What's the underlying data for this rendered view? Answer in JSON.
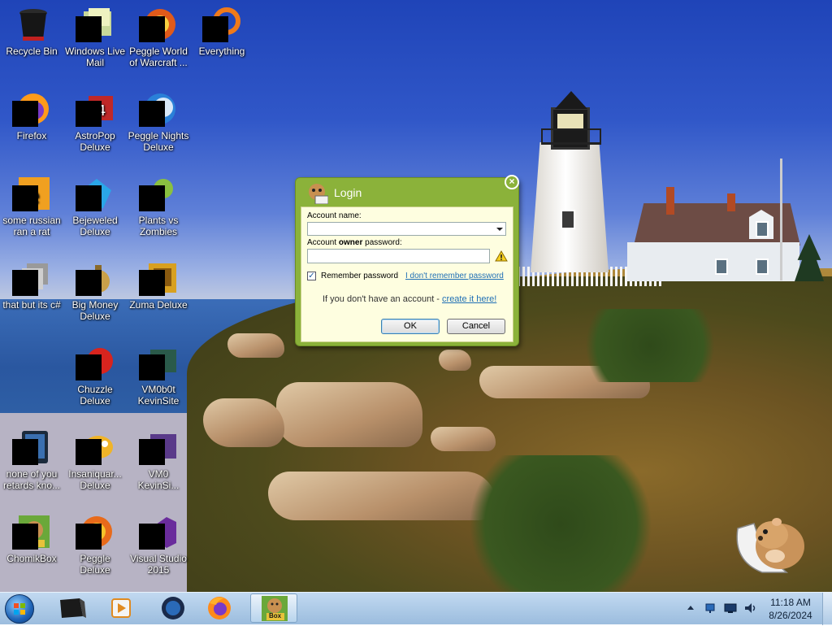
{
  "desktop": {
    "icons": [
      {
        "label": "Recycle Bin"
      },
      {
        "label": "Windows Live\nMail"
      },
      {
        "label": "Peggle World\nof Warcraft ..."
      },
      {
        "label": "Everything"
      },
      {
        "label": "Firefox"
      },
      {
        "label": "AstroPop\nDeluxe"
      },
      {
        "label": "Peggle Nights\nDeluxe"
      },
      {
        "label": "some russian\nran a rat"
      },
      {
        "label": "Bejeweled\nDeluxe"
      },
      {
        "label": "Plants vs\nZombies"
      },
      {
        "label": "that but its c#"
      },
      {
        "label": "Big Money\nDeluxe"
      },
      {
        "label": "Zuma Deluxe"
      },
      {
        "label": "Chuzzle\nDeluxe"
      },
      {
        "label": "VM0b0t\nKevinSite"
      },
      {
        "label": "none of you\nretards kno..."
      },
      {
        "label": "Insaniquar...\nDeluxe"
      },
      {
        "label": "VM0\nKevinSi..."
      },
      {
        "label": "ChomikBox"
      },
      {
        "label": "Peggle Deluxe"
      },
      {
        "label": "Visual Studio\n2015"
      }
    ]
  },
  "login": {
    "title": "Login",
    "close_glyph": "×",
    "account_name_label": "Account name:",
    "account_name_value": "",
    "password_label_prefix": "Account ",
    "password_label_bold": "owner",
    "password_label_suffix": " password:",
    "password_value": "",
    "remember_label": "Remember password",
    "remember_checked": true,
    "forgot_link": "I don't remember password",
    "no_account_text": "If you don't have an account - ",
    "create_link": "create it here!",
    "ok_label": "OK",
    "cancel_label": "Cancel",
    "colors": {
      "frame": "#8bb23a",
      "panel": "#fefee0",
      "link": "#1f6fb5"
    }
  },
  "taskbar": {
    "items": [
      {
        "icon": "start-orb-icon"
      },
      {
        "icon": "app-black-box-icon"
      },
      {
        "icon": "media-player-icon"
      },
      {
        "icon": "globe-browser-icon"
      },
      {
        "icon": "firefox-icon"
      },
      {
        "icon": "chomikbox-icon",
        "badge": "Box",
        "active": true
      }
    ],
    "tray_icons": [
      "network-icon",
      "monitor-icon",
      "volume-icon"
    ],
    "clock": {
      "time": "11:18 AM",
      "date": "8/26/2024"
    }
  }
}
